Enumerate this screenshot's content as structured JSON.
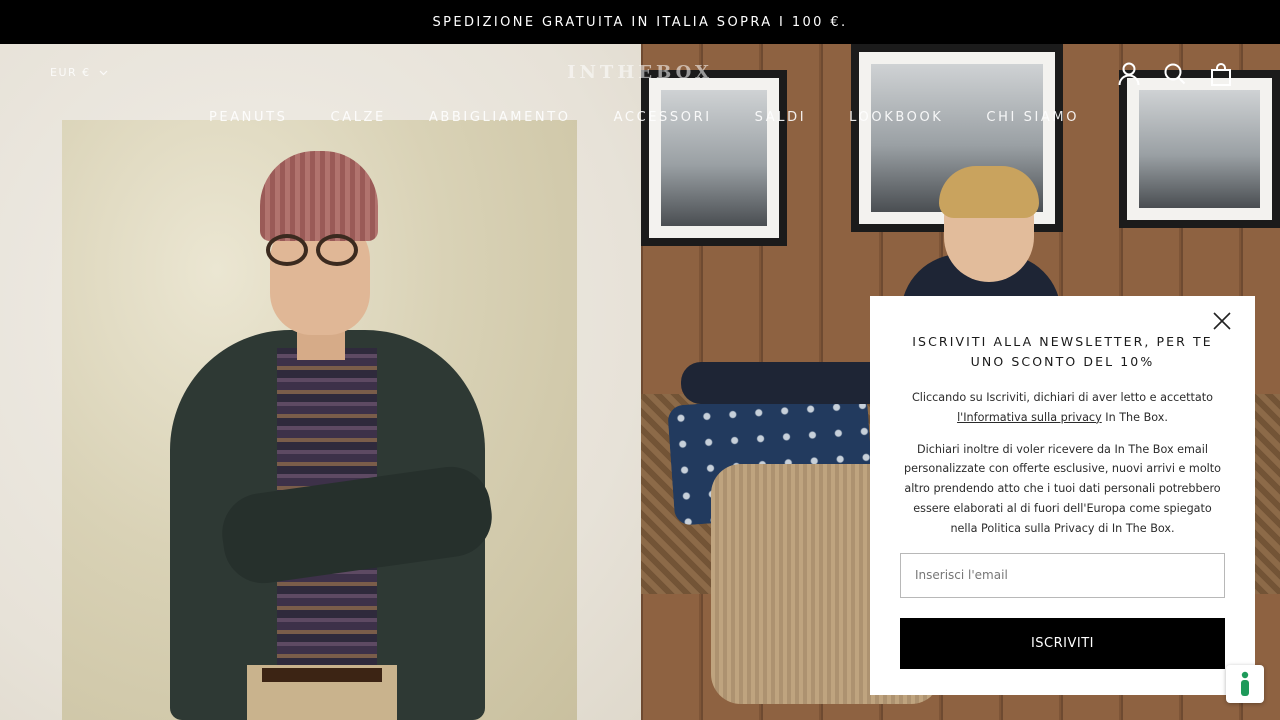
{
  "announcement": {
    "text": "SPEDIZIONE GRATUITA IN ITALIA SOPRA I 100 €."
  },
  "header": {
    "currency": "EUR €",
    "logo": "INTHEBOX",
    "icons": [
      "account-icon",
      "search-icon",
      "cart-icon"
    ]
  },
  "nav": {
    "items": [
      {
        "label": "PEANUTS"
      },
      {
        "label": "CALZE"
      },
      {
        "label": "ABBIGLIAMENTO"
      },
      {
        "label": "ACCESSORI"
      },
      {
        "label": "SALDI"
      },
      {
        "label": "LOOKBOOK"
      },
      {
        "label": "CHI SIAMO"
      }
    ]
  },
  "newsletter": {
    "title": "ISCRIVITI ALLA NEWSLETTER, PER TE UNO SCONTO DEL 10%",
    "consent_prefix": "Cliccando su Iscriviti, dichiari di aver letto e accettato",
    "privacy_link": "l'Informativa sulla privacy",
    "consent_suffix": " In The Box.",
    "marketing_text": "Dichiari inoltre di voler ricevere da In The Box email personalizzate con offerte esclusive, nuovi arrivi e molto altro prendendo atto che i tuoi dati personali potrebbero essere elaborati al di fuori dell'Europa come spiegato nella Politica sulla Privacy di In The Box.",
    "email_placeholder": "Inserisci l'email",
    "submit_label": "ISCRIVITI"
  },
  "colors": {
    "announcement_bg": "#000000",
    "button_bg": "#000000",
    "popup_bg": "#ffffff"
  }
}
